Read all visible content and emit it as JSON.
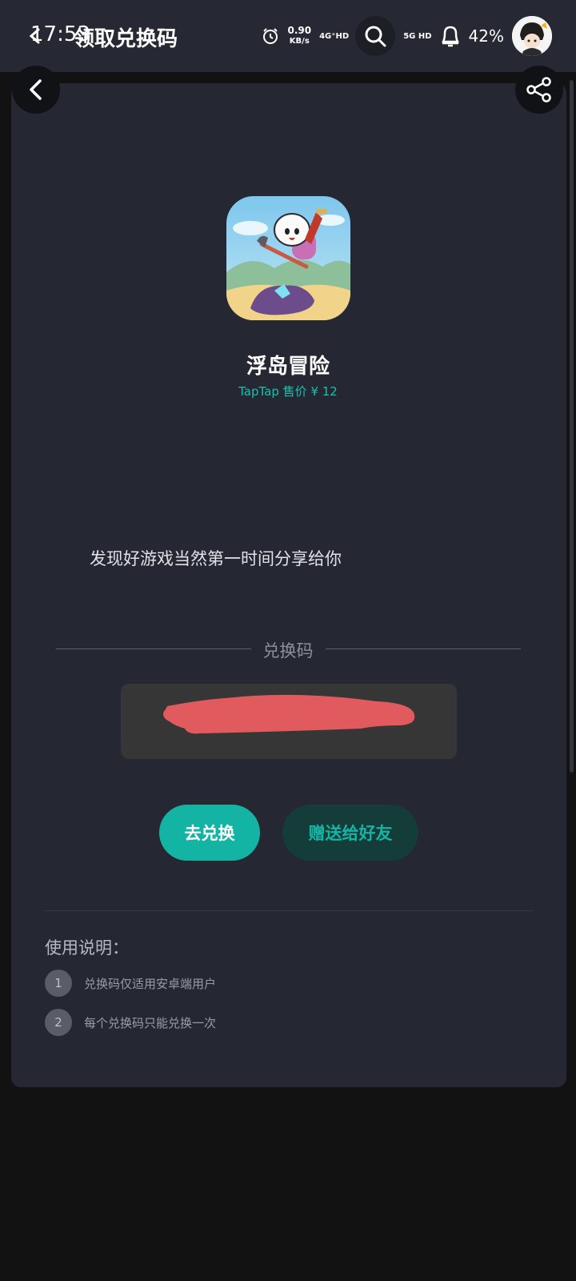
{
  "status_bar": {
    "time": "17:53",
    "speed_value": "0.90",
    "speed_unit": "KB/s",
    "net_1": "4G⁺HD",
    "net_2": "5G HD",
    "battery": "42%"
  },
  "header": {
    "title": "领取兑换码"
  },
  "game": {
    "name": "浮岛冒险",
    "price": "TapTap 售价 ¥ 12"
  },
  "share_message": "发现好游戏当然第一时间分享给你",
  "code_section": {
    "label": "兑换码"
  },
  "buttons": {
    "redeem": "去兑换",
    "gift": "赠送给好友"
  },
  "instructions": {
    "title": "使用说明：",
    "items": [
      {
        "num": "1",
        "text": "兑换码仅适用安卓端用户"
      },
      {
        "num": "2",
        "text": "每个兑换码只能兑换一次"
      }
    ]
  },
  "colors": {
    "accent": "#14b4a4",
    "card_bg": "#252733",
    "page_bg": "#121212",
    "redaction": "#e05a5e"
  },
  "icons": [
    "back-arrow-icon",
    "share-icon",
    "alarm-icon",
    "search-icon",
    "bell-icon",
    "avatar"
  ]
}
